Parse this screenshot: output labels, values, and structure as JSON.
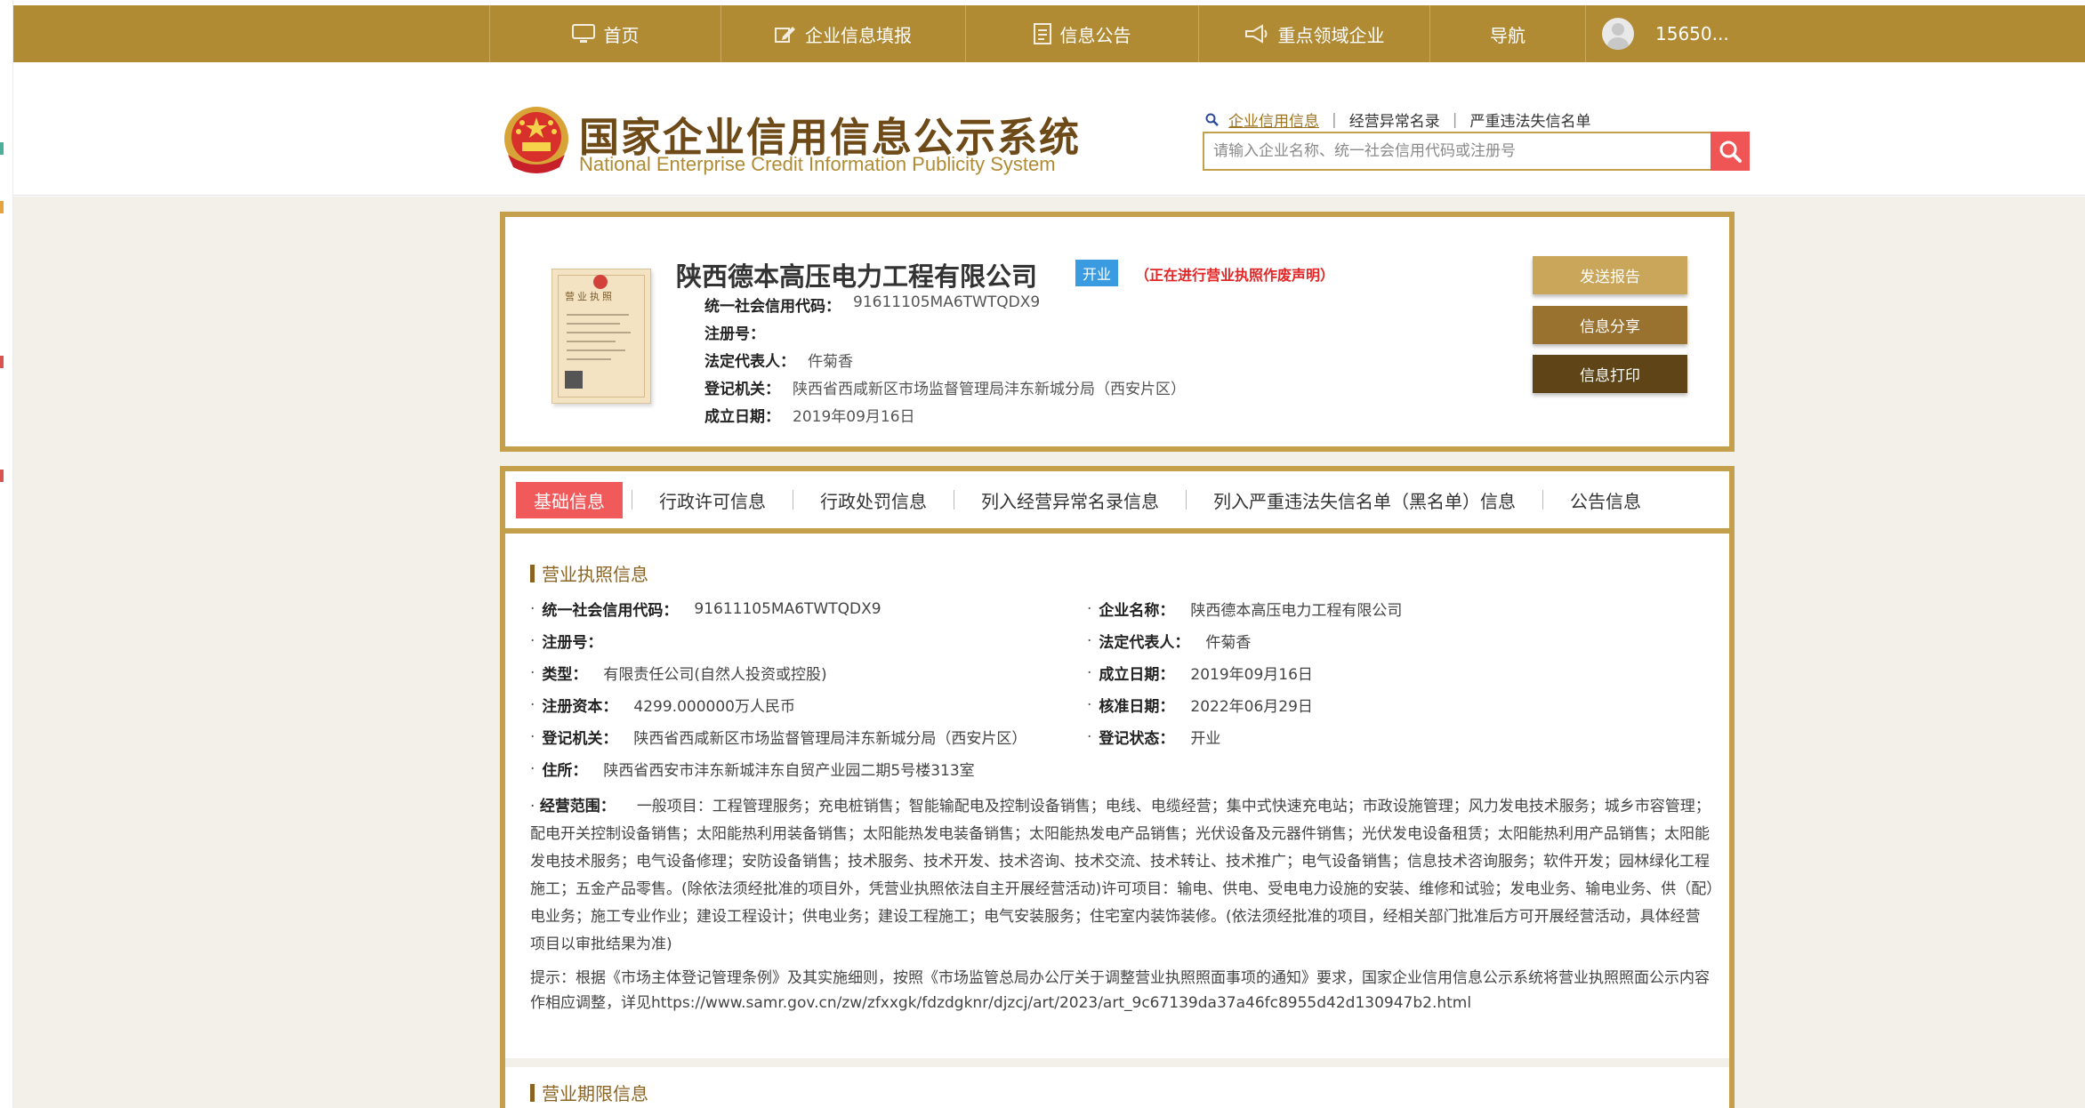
{
  "nav": {
    "items": [
      {
        "label": "首页",
        "icon": "monitor-icon"
      },
      {
        "label": "企业信息填报",
        "icon": "edit-icon"
      },
      {
        "label": "信息公告",
        "icon": "document-icon"
      },
      {
        "label": "重点领域企业",
        "icon": "megaphone-icon"
      },
      {
        "label": "导航",
        "icon": ""
      }
    ],
    "user": "15650..."
  },
  "header": {
    "title_cn": "国家企业信用信息公示系统",
    "title_en": "National Enterprise Credit Information Publicity System",
    "search_links": [
      "企业信用信息",
      "经营异常名录",
      "严重违法失信名单"
    ],
    "search_placeholder": "请输入企业名称、统一社会信用代码或注册号"
  },
  "company": {
    "name": "陕西德本高压电力工程有限公司",
    "status": "开业",
    "note": "（正在进行营业执照作废声明）",
    "rows": [
      {
        "label": "统一社会信用代码：",
        "value": "91611105MA6TWTQDX9"
      },
      {
        "label": "注册号：",
        "value": ""
      },
      {
        "label": "法定代表人：",
        "value": "仵菊香"
      },
      {
        "label": "登记机关：",
        "value": "陕西省西咸新区市场监督管理局沣东新城分局（西安片区）"
      },
      {
        "label": "成立日期：",
        "value": "2019年09月16日"
      }
    ],
    "buttons": [
      "发送报告",
      "信息分享",
      "信息打印"
    ],
    "license_title": "营业执照"
  },
  "tabs": [
    "基础信息",
    "行政许可信息",
    "行政处罚信息",
    "列入经营异常名录信息",
    "列入严重违法失信名单（黑名单）信息",
    "公告信息"
  ],
  "basic": {
    "section_title": "营业执照信息",
    "left": [
      {
        "label": "统一社会信用代码：",
        "value": "91611105MA6TWTQDX9"
      },
      {
        "label": "注册号：",
        "value": ""
      },
      {
        "label": "类型：",
        "value": "有限责任公司(自然人投资或控股)"
      },
      {
        "label": "注册资本：",
        "value": "4299.000000万人民币"
      },
      {
        "label": "登记机关：",
        "value": "陕西省西咸新区市场监督管理局沣东新城分局（西安片区）"
      },
      {
        "label": "住所：",
        "value": "陕西省西安市沣东新城沣东自贸产业园二期5号楼313室"
      }
    ],
    "right": [
      {
        "label": "企业名称：",
        "value": "陕西德本高压电力工程有限公司"
      },
      {
        "label": "法定代表人：",
        "value": "仵菊香"
      },
      {
        "label": "成立日期：",
        "value": "2019年09月16日"
      },
      {
        "label": "核准日期：",
        "value": "2022年06月29日"
      },
      {
        "label": "登记状态：",
        "value": "开业"
      }
    ],
    "scope_label": "经营范围：",
    "scope_value": "一般项目：工程管理服务；充电桩销售；智能输配电及控制设备销售；电线、电缆经营；集中式快速充电站；市政设施管理；风力发电技术服务；城乡市容管理；配电开关控制设备销售；太阳能热利用装备销售；太阳能热发电装备销售；太阳能热发电产品销售；光伏设备及元器件销售；光伏发电设备租赁；太阳能热利用产品销售；太阳能发电技术服务；电气设备修理；安防设备销售；技术服务、技术开发、技术咨询、技术交流、技术转让、技术推广；电气设备销售；信息技术咨询服务；软件开发；园林绿化工程施工；五金产品零售。(除依法须经批准的项目外，凭营业执照依法自主开展经营活动)许可项目：输电、供电、受电电力设施的安装、维修和试验；发电业务、输电业务、供（配）电业务；施工专业作业；建设工程设计；供电业务；建设工程施工；电气安装服务；住宅室内装饰装修。(依法须经批准的项目，经相关部门批准后方可开展经营活动，具体经营项目以审批结果为准)",
    "notice": "提示：根据《市场主体登记管理条例》及其实施细则，按照《市场监管总局办公厅关于调整营业执照照面事项的通知》要求，国家企业信用信息公示系统将营业执照照面公示内容作相应调整，详见https://www.samr.gov.cn/zw/zfxxgk/fdzdgknr/djzcj/art/2023/art_9c67139da37a46fc8955d42d130947b2.html",
    "next_section": "营业期限信息"
  },
  "colors": {
    "gold": "#b08b33",
    "frame": "#c4a04d",
    "tab_active": "#f05a5a",
    "status_tag": "#3a9be0",
    "alert": "#e42525",
    "btn_send": "#c9a65a",
    "btn_share": "#9a7230",
    "btn_print": "#5e4416"
  }
}
